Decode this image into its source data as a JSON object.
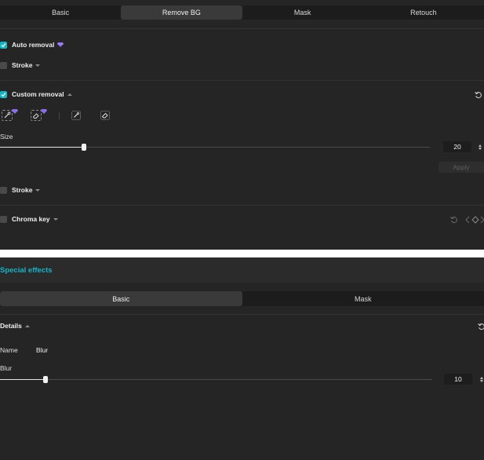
{
  "top_panel": {
    "tabs": [
      {
        "label": "Basic",
        "active": false
      },
      {
        "label": "Remove BG",
        "active": true
      },
      {
        "label": "Mask",
        "active": false
      },
      {
        "label": "Retouch",
        "active": false
      }
    ],
    "auto_removal": {
      "label": "Auto removal",
      "checked": true,
      "pro_icon": "gem-icon"
    },
    "stroke_1": {
      "label": "Stroke",
      "checked": false
    },
    "custom_removal": {
      "label": "Custom removal",
      "checked": true,
      "expanded": true
    },
    "tools": [
      "smart-brush-icon",
      "smart-eraser-icon",
      "brush-icon",
      "eraser-icon"
    ],
    "size": {
      "label": "Size",
      "value": "20",
      "level_fraction": 0.196
    },
    "apply_label": "Apply",
    "stroke_2": {
      "label": "Stroke",
      "checked": false
    },
    "chroma_key": {
      "label": "Chroma key",
      "checked": false
    }
  },
  "bottom_panel": {
    "title": "Special effects",
    "tabs": [
      {
        "label": "Basic",
        "active": true
      },
      {
        "label": "Mask",
        "active": false
      }
    ],
    "details": {
      "label": "Details",
      "expanded": true
    },
    "name": {
      "label": "Name",
      "value": "Blur"
    },
    "blur": {
      "label": "Blur",
      "value": "10",
      "level_fraction": 0.106
    }
  },
  "colors": {
    "accent": "#13b5c7",
    "panel_bg": "#252525",
    "divider_bg": "#ffffff",
    "header_bg": "#2b2b2b",
    "tab_active": "#3a3a3a"
  }
}
